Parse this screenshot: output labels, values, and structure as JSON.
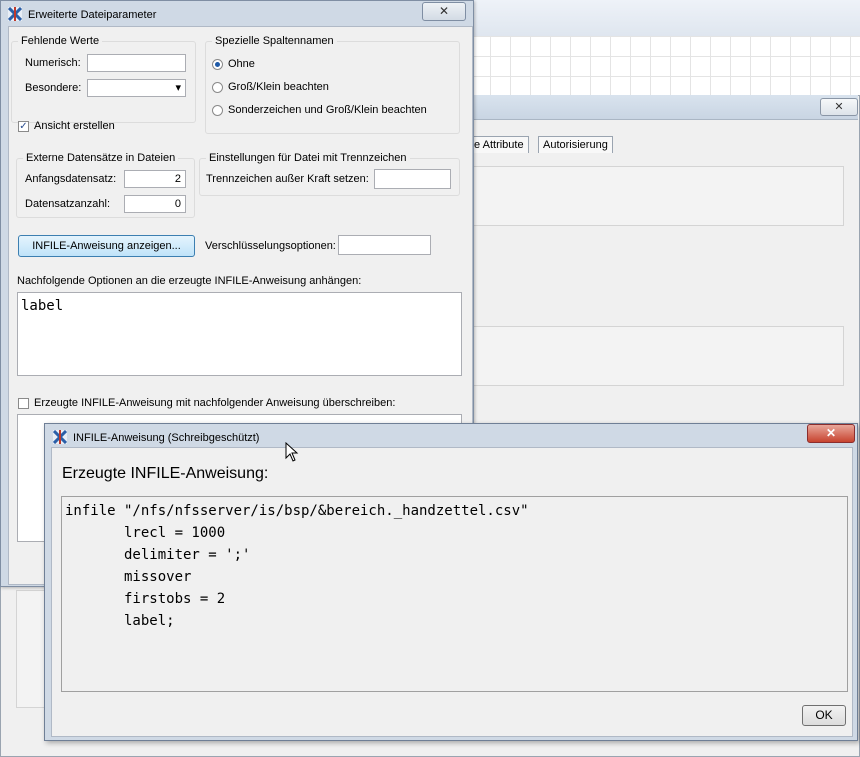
{
  "background": {
    "tabs": [
      "te Attribute",
      "Autorisierung"
    ],
    "close_glyph": "✕"
  },
  "dialog": {
    "title": "Erweiterte Dateiparameter",
    "close_glyph": "✕",
    "missing": {
      "legend": "Fehlende Werte",
      "numeric_label": "Numerisch:",
      "numeric_value": "",
      "special_label": "Besondere:",
      "special_value": "",
      "dropdown_glyph": "▾"
    },
    "colnames": {
      "legend": "Spezielle Spaltennamen",
      "options": [
        "Ohne",
        "Groß/Klein beachten",
        "Sonderzeichen und Groß/Klein beachten"
      ],
      "selected_index": 0
    },
    "view_checkbox": {
      "label": "Ansicht erstellen",
      "checked": true,
      "glyph": "✓"
    },
    "external": {
      "legend": "Externe Datensätze in Dateien",
      "start_label": "Anfangsdatensatz:",
      "start_value": "2",
      "count_label": "Datensatzanzahl:",
      "count_value": "0"
    },
    "delimiter": {
      "legend": "Einstellungen für Datei mit Trennzeichen",
      "override_label": "Trennzeichen außer Kraft setzen:",
      "override_value": ""
    },
    "infile_button": "INFILE-Anweisung anzeigen...",
    "encryption_label": "Verschlüsselungsoptionen:",
    "encryption_value": "",
    "append_label": "Nachfolgende Optionen an die erzeugte INFILE-Anweisung anhängen:",
    "append_value": "label",
    "overwrite_checkbox": {
      "label": "Erzeugte INFILE-Anweisung mit nachfolgender Anweisung überschreiben:",
      "checked": false
    }
  },
  "popup": {
    "title": "INFILE-Anweisung (Schreibgeschützt)",
    "close_glyph": "✕",
    "heading": "Erzeugte INFILE-Anweisung:",
    "code_lines": [
      "infile \"/nfs/nfsserver/is/bsp/&bereich._handzettel.csv\"",
      "       lrecl = 1000",
      "       delimiter = ';'",
      "       missover",
      "       firstobs = 2",
      "       label;"
    ],
    "ok_label": "OK"
  },
  "colors": {
    "title_bar": "#cfd9e5",
    "client_bg": "#f0f0f0",
    "accent_button": "#bfe3f9",
    "close_red": "#c7432f"
  }
}
